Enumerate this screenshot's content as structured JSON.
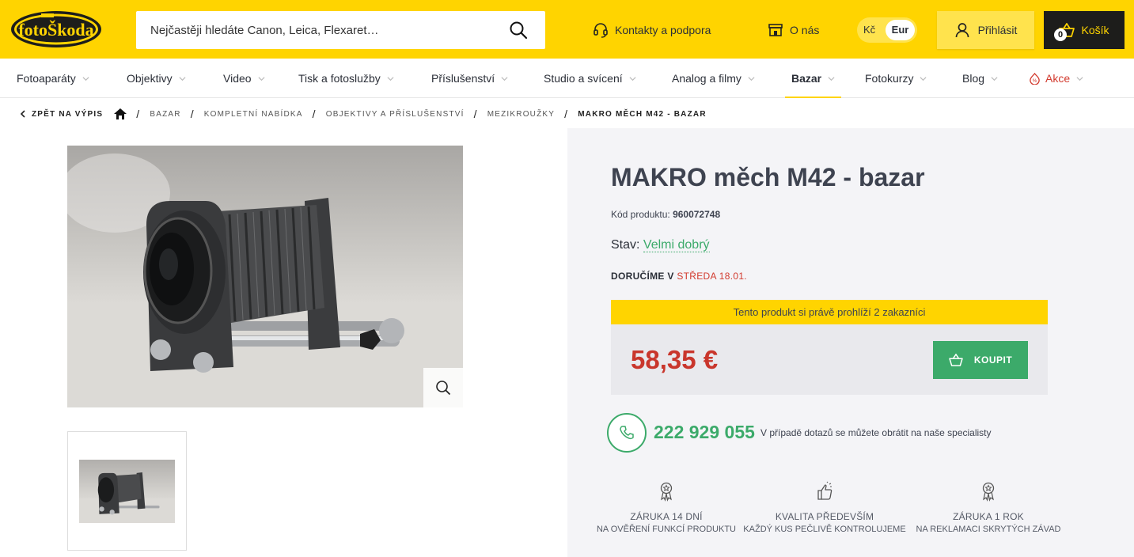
{
  "header": {
    "logo_text": "fotoŠkoda",
    "search_placeholder": "Nejčastěji hledáte Canon, Leica, Flexaret…",
    "contact": "Kontakty a podpora",
    "about": "O nás",
    "currency": {
      "kc": "Kč",
      "eur": "Eur"
    },
    "login": "Přihlásit",
    "cart_label": "Košík",
    "cart_count": "0"
  },
  "nav": [
    {
      "label": "Fotoaparáty"
    },
    {
      "label": "Objektivy"
    },
    {
      "label": "Video"
    },
    {
      "label": "Tisk a fotoslužby"
    },
    {
      "label": "Příslušenství"
    },
    {
      "label": "Studio a svícení"
    },
    {
      "label": "Analog a filmy"
    },
    {
      "label": "Bazar"
    },
    {
      "label": "Fotokurzy"
    },
    {
      "label": "Blog"
    },
    {
      "label": "Akce"
    }
  ],
  "breadcrumb": {
    "back": "Zpět na výpis",
    "items": [
      "Bazar",
      "Kompletní nabídka",
      "Objektivy a příslušenství",
      "Mezikroužky"
    ],
    "current": "MAKRO měch M42 - bazar"
  },
  "product": {
    "title": "MAKRO měch M42 - bazar",
    "code_label": "Kód produktu:",
    "code": "960072748",
    "state_label": "Stav:",
    "state": "Velmi dobrý",
    "delivery_label": "DORUČÍME V",
    "delivery_date": "STŘEDA 18.01.",
    "viewing": "Tento produkt si právě prohlíží 2 zakazníci",
    "price": "58,35 €",
    "buy": "KOUPIT"
  },
  "support": {
    "phone": "222 929 055",
    "note": "V případě dotazů se můžete obrátit na naše specialisty"
  },
  "features": [
    {
      "t1": "ZÁRUKA 14 DNÍ",
      "t2": "NA OVĚŘENÍ FUNKCÍ PRODUKTU"
    },
    {
      "t1": "KVALITA PŘEDEVŠÍM",
      "t2": "KAŽDÝ KUS PEČLIVĚ KONTROLUJEME"
    },
    {
      "t1": "ZÁRUKA 1 ROK",
      "t2": "NA REKLAMACI SKRYTÝCH ZÁVAD"
    }
  ],
  "colors": {
    "brand_yellow": "#ffd400",
    "accent_green": "#3caa6a",
    "price_red": "#c9362c"
  }
}
